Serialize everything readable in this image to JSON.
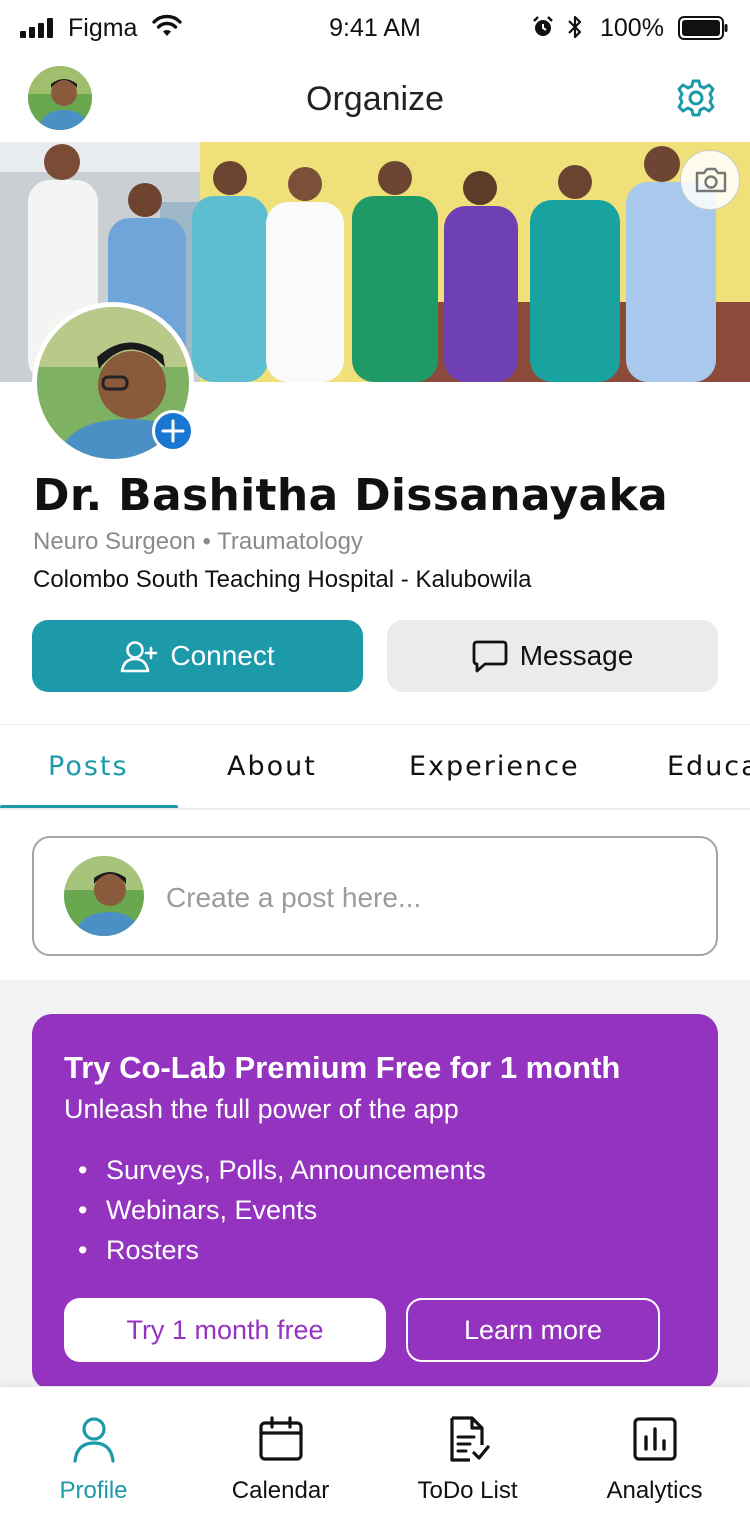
{
  "status_bar": {
    "carrier": "Figma",
    "time": "9:41 AM",
    "battery": "100%"
  },
  "header": {
    "title": "Organize",
    "settings_icon": "gear-icon"
  },
  "profile": {
    "name": "Dr. Bashitha Dissanayaka",
    "specialty": "Neuro Surgeon • Traumatology",
    "hospital": "Colombo South Teaching Hospital - Kalubowila"
  },
  "actions": {
    "connect_label": "Connect",
    "message_label": "Message"
  },
  "tabs": [
    {
      "label": "Posts",
      "active": true
    },
    {
      "label": "About"
    },
    {
      "label": "Experience"
    },
    {
      "label": "Education"
    }
  ],
  "composer": {
    "placeholder": "Create a post here..."
  },
  "premium": {
    "title": "Try Co-Lab Premium Free for 1 month",
    "subtitle": "Unleash the full power of the app",
    "features": [
      "Surveys, Polls, Announcements",
      "Webinars, Events",
      "Rosters"
    ],
    "try_label": "Try 1 month free",
    "learn_label": "Learn more"
  },
  "bottom_nav": [
    {
      "label": "Profile",
      "icon": "person-icon",
      "active": true
    },
    {
      "label": "Calendar",
      "icon": "calendar-icon"
    },
    {
      "label": "ToDo List",
      "icon": "document-check-icon"
    },
    {
      "label": "Analytics",
      "icon": "bar-chart-icon"
    }
  ],
  "colors": {
    "accent": "#1d9aa9",
    "premium": "#9533c1",
    "add_badge": "#1976d2"
  }
}
